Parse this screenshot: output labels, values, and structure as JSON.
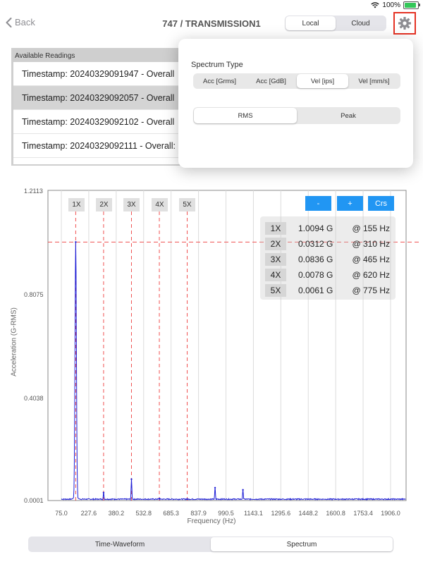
{
  "status": {
    "battery_percent": "100%"
  },
  "nav": {
    "back_label": "Back",
    "title": "747 / TRANSMISSION1",
    "source_options": [
      "Local",
      "Cloud"
    ],
    "source_selected": "Local"
  },
  "readings": {
    "header": "Available Readings",
    "items": [
      "Timestamp: 20240329091947 - Overall",
      "Timestamp: 20240329092057 - Overall",
      "Timestamp: 20240329092102 - Overall",
      "Timestamp: 20240329092111 - Overall:"
    ],
    "selected_index": 1
  },
  "popover": {
    "spectrum_type_label": "Spectrum Type",
    "spectrum_options": [
      "Acc [Grms]",
      "Acc [GdB]",
      "Vel [ips]",
      "Vel [mm/s]"
    ],
    "spectrum_selected": "Vel [ips]",
    "measure_options": [
      "RMS",
      "Peak"
    ],
    "measure_selected": "RMS"
  },
  "chart_controls": {
    "minus": "-",
    "plus": "+",
    "cursor": "Crs"
  },
  "harmonics": [
    {
      "order": "1X",
      "amp": "1.0094 G",
      "freq": "@ 155 Hz"
    },
    {
      "order": "2X",
      "amp": "0.0312 G",
      "freq": "@ 310 Hz"
    },
    {
      "order": "3X",
      "amp": "0.0836 G",
      "freq": "@ 465 Hz"
    },
    {
      "order": "4X",
      "amp": "0.0078 G",
      "freq": "@ 620 Hz"
    },
    {
      "order": "5X",
      "amp": "0.0061 G",
      "freq": "@ 775 Hz"
    }
  ],
  "chart_data": {
    "type": "line",
    "xlabel": "Frequency (Hz)",
    "ylabel": "Acceleration (G-RMS)",
    "xlim": [
      0,
      2000
    ],
    "ylim": [
      0.0001,
      1.2113
    ],
    "yticks": [
      "1.2113",
      "0.8075",
      "0.4038",
      "0.0001"
    ],
    "ytick_values": [
      1.2113,
      0.8075,
      0.4038,
      0.0001
    ],
    "xticks": [
      "75.0",
      "227.6",
      "380.2",
      "532.8",
      "685.3",
      "837.9",
      "990.5",
      "1143.1",
      "1295.6",
      "1448.2",
      "1600.8",
      "1753.4",
      "1906.0"
    ],
    "xtick_values": [
      75.0,
      227.6,
      380.2,
      532.8,
      685.3,
      837.9,
      990.5,
      1143.1,
      1295.6,
      1448.2,
      1600.8,
      1753.4,
      1906.0
    ],
    "harmonic_markers": [
      {
        "label": "1X",
        "x": 155
      },
      {
        "label": "2X",
        "x": 310
      },
      {
        "label": "3X",
        "x": 465
      },
      {
        "label": "4X",
        "x": 620
      },
      {
        "label": "5X",
        "x": 775
      }
    ],
    "reference_level": 1.0094,
    "peaks": [
      {
        "x": 155,
        "y": 1.0094
      },
      {
        "x": 310,
        "y": 0.0312
      },
      {
        "x": 465,
        "y": 0.0836
      },
      {
        "x": 620,
        "y": 0.0078
      },
      {
        "x": 775,
        "y": 0.0061
      },
      {
        "x": 930,
        "y": 0.05
      },
      {
        "x": 1085,
        "y": 0.042
      }
    ],
    "series_color": "#1f1fd6",
    "marker_color": "#f05050"
  },
  "bottom_tabs": {
    "options": [
      "Time-Waveform",
      "Spectrum"
    ],
    "selected": "Spectrum"
  }
}
